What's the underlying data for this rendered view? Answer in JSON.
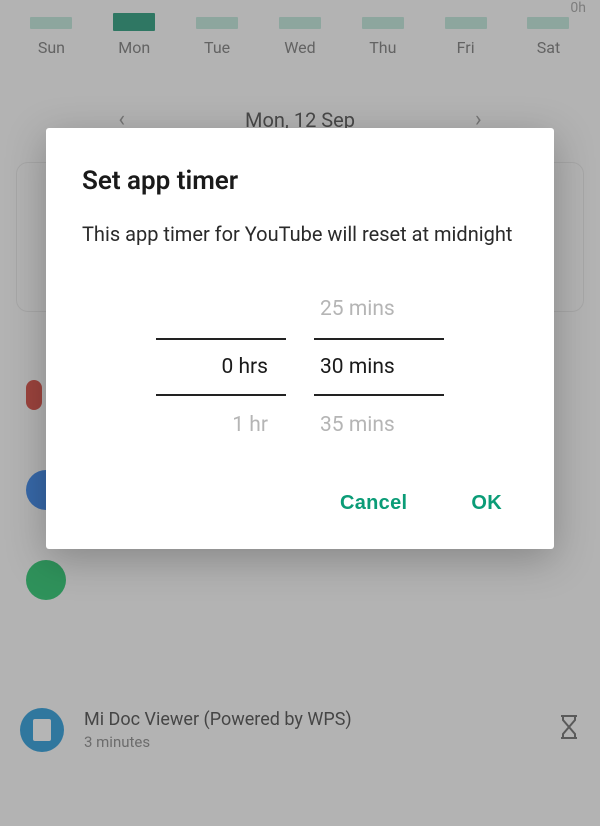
{
  "background": {
    "hours_axis_label": "0h",
    "weekdays": [
      "Sun",
      "Mon",
      "Tue",
      "Wed",
      "Thu",
      "Fri",
      "Sat"
    ],
    "selected_date": "Mon, 12 Sep",
    "list_item": {
      "title": "Mi Doc Viewer (Powered by WPS)",
      "subtitle": "3 minutes"
    }
  },
  "dialog": {
    "title": "Set app timer",
    "description": "This app timer for YouTube will reset at midnight",
    "hours_prev": "",
    "hours_selected": "0 hrs",
    "hours_next": "1 hr",
    "mins_prev": "25 mins",
    "mins_selected": "30 mins",
    "mins_next": "35 mins",
    "cancel_label": "Cancel",
    "ok_label": "OK"
  }
}
